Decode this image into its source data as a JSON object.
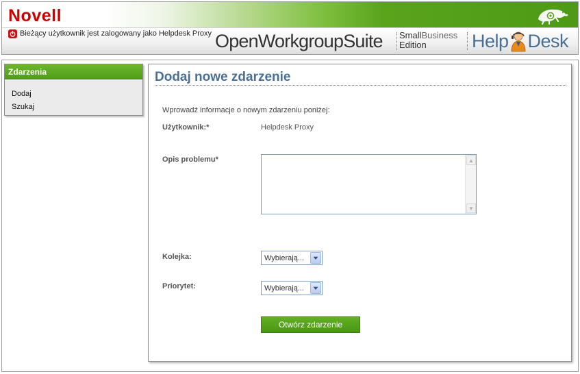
{
  "header": {
    "logo": "Novell",
    "user_status": "Bieżący użytkownik jest zalogowany jako Helpdesk Proxy",
    "brand_open_workgroup": "OpenWorkgroup",
    "brand_suite": "Suite",
    "brand_small": "Small",
    "brand_business": "Business",
    "brand_edition": "Edition",
    "brand_help": "Help",
    "brand_desk": "Desk",
    "icons": [
      "power-icon",
      "gecko-icon",
      "helpdesk-person-icon"
    ],
    "colors": {
      "novell_red": "#cc0000",
      "band_green": "#4d9a16",
      "helpdesk_blue": "#4a6f94"
    }
  },
  "sidebar": {
    "title": "Zdarzenia",
    "items": [
      {
        "label": "Dodaj"
      },
      {
        "label": "Szukaj"
      }
    ]
  },
  "main": {
    "title": "Dodaj nowe zdarzenie",
    "intro": "Wprowadź informacje o nowym zdarzeniu poniżej:",
    "user_label": "Użytkownik:*",
    "user_value": "Helpdesk Proxy",
    "description_label": "Opis problemu*",
    "description_value": "",
    "queue_label": "Kolejka:",
    "queue_selected": "Wybierają...",
    "priority_label": "Priorytet:",
    "priority_selected": "Wybierają...",
    "submit_label": "Otwórz zdarzenie"
  }
}
